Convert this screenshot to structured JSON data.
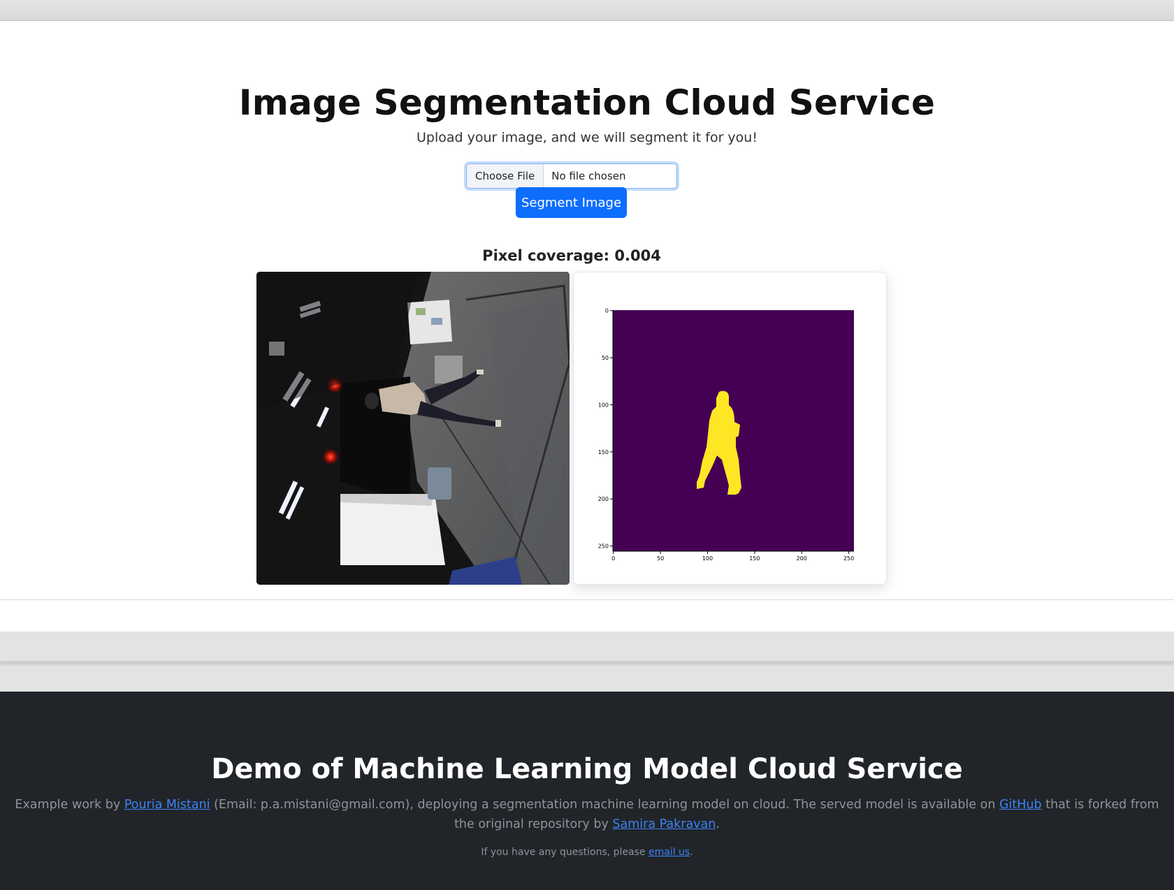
{
  "header": {
    "title": "Image Segmentation Cloud Service",
    "subtitle": "Upload your image, and we will segment it for you!"
  },
  "upload": {
    "choose_label": "Choose File",
    "file_status": "No file chosen",
    "submit_label": "Segment Image"
  },
  "result": {
    "coverage_text": "Pixel coverage: 0.004",
    "mask_axis": {
      "y_ticks": [
        "0",
        "50",
        "100",
        "150",
        "200",
        "250"
      ],
      "x_ticks": [
        "0",
        "50",
        "100",
        "150",
        "200",
        "250"
      ],
      "background_color": "#440154",
      "mask_color": "#fde725"
    }
  },
  "footer": {
    "title": "Demo of Machine Learning Model Cloud Service",
    "desc_1": "Example work by ",
    "author_link": "Pouria Mistani",
    "desc_2": " (Email: p.a.mistani@gmail.com), deploying a segmentation machine learning model on cloud. The served model is available on ",
    "github_link": "GitHub",
    "desc_3": " that is forked from the original repository by ",
    "original_author_link": "Samira Pakravan",
    "desc_4": ".",
    "note_1": "If you have any questions, please ",
    "email_link": "email us",
    "note_2": "."
  },
  "colors": {
    "primary": "#0d6efd",
    "footer_bg": "#212529",
    "link": "#3b82f6"
  }
}
